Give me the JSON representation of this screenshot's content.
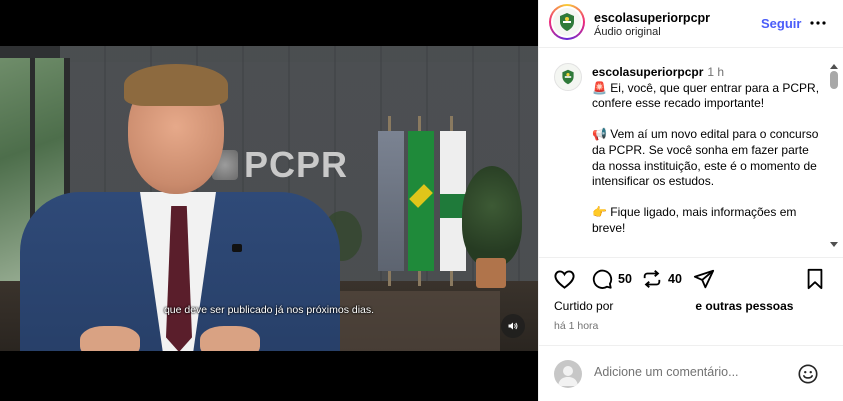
{
  "video": {
    "subtitle": "que deve ser publicado já nos próximos dias.",
    "brand_text": "PCPR"
  },
  "header": {
    "username": "escolasuperiorpcpr",
    "audio_label": "Áudio original",
    "follow_label": "Seguir"
  },
  "caption": {
    "username": "escolasuperiorpcpr",
    "time": "1 h",
    "paragraphs": [
      "🚨 Ei, você, que quer entrar para a PCPR, confere esse recado importante!",
      "📢 Vem aí um novo edital para o concurso da PCPR. Se você sonha em fazer parte da nossa instituição, este é o momento de intensificar os estudos.",
      "👉 Fique ligado, mais informações em breve!"
    ]
  },
  "actions": {
    "comment_count": "50",
    "repost_count": "40"
  },
  "likes": {
    "prefix": "Curtido por",
    "suffix": "e outras pessoas"
  },
  "post_time": "há 1 hora",
  "comment_box": {
    "placeholder": "Adicione um comentário..."
  },
  "icons": {
    "like": "heart-icon",
    "comment": "comment-bubble-icon",
    "repost": "repost-icon",
    "share": "send-icon",
    "save": "bookmark-icon",
    "more": "more-dots-icon",
    "emoji": "emoji-icon",
    "sound": "speaker-icon"
  }
}
